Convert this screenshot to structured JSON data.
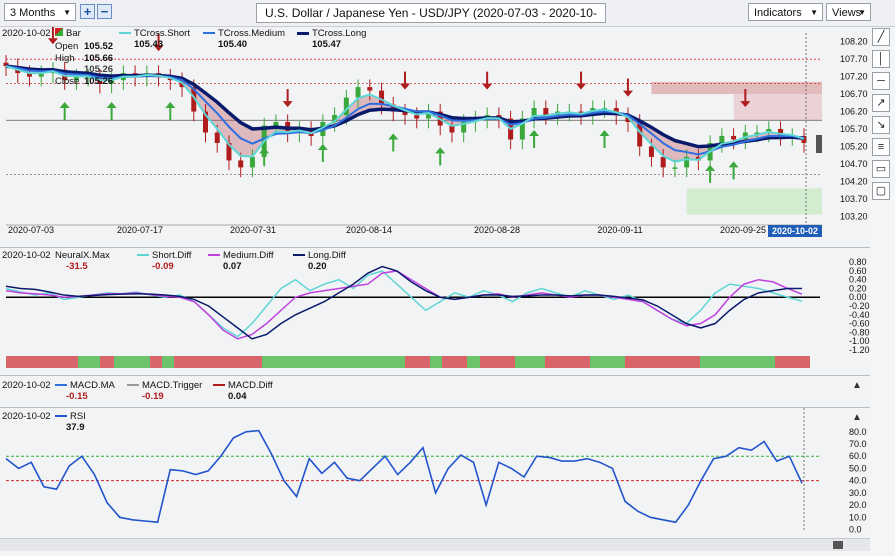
{
  "toolbar": {
    "period": "3 Months",
    "zoom_in": "+",
    "zoom_out": "−",
    "title": "U.S. Dollar / Japanese Yen - USD/JPY (2020-07-03 - 2020-10-05)",
    "indicators": "Indicators",
    "views": "Views"
  },
  "right_tools": [
    "╱",
    "│",
    "─",
    "↗",
    "↘",
    "≡",
    "▭",
    "▢"
  ],
  "legend_main": {
    "date": "2020-10-02",
    "bar_label": "Bar",
    "open_label": "Open",
    "open": "105.52",
    "high_label": "High",
    "high": "105.66",
    "low_label": "Low",
    "low": "105.26",
    "close_label": "Close",
    "close": "105.26",
    "short_label": "TCross.Short",
    "short": "105.43",
    "medium_label": "TCross.Medium",
    "medium": "105.40",
    "long_label": "TCross.Long",
    "long": "105.47"
  },
  "legend_neural": {
    "date": "2020-10-02",
    "nm_label": "NeuralX.Max",
    "nm": "-31.5",
    "sd_label": "Short.Diff",
    "sd": "-0.09",
    "md_label": "Medium.Diff",
    "md": "0.07",
    "ld_label": "Long.Diff",
    "ld": "0.20"
  },
  "legend_macd": {
    "date": "2020-10-02",
    "ma_label": "MACD.MA",
    "ma": "-0.15",
    "tr_label": "MACD.Trigger",
    "tr": "-0.19",
    "df_label": "MACD.Diff",
    "df": "0.04"
  },
  "legend_rsi": {
    "date": "2020-10-02",
    "label": "RSI",
    "value": "37.9"
  },
  "colors": {
    "short": "#5ed6d6",
    "medium": "#2f6fe0",
    "long": "#0a1a6b",
    "up": "#3aa83a",
    "down": "#b01c1c",
    "neural_green": "#6cc36c",
    "neural_red": "#d9646a",
    "rsi": "#2255cc",
    "overbought": "#35b035",
    "oversold": "#d02a2a",
    "highlight": "#1f5fb8"
  },
  "chart_data": [
    {
      "type": "candlestick",
      "title": "U.S. Dollar / Japanese Yen - USD/JPY (2020-07-03 - 2020-10-05)",
      "x_ticks": [
        "2020-07-03",
        "2020-07-17",
        "2020-07-31",
        "2020-08-14",
        "2020-08-28",
        "2020-09-11",
        "2020-09-25",
        "2020-10-02"
      ],
      "y_ticks": [
        103.2,
        103.7,
        104.2,
        104.7,
        105.2,
        105.7,
        106.2,
        106.7,
        107.2,
        107.7,
        108.2
      ],
      "ylim": [
        102.95,
        108.45
      ],
      "close": [
        107.5,
        107.3,
        107.2,
        107.3,
        107.4,
        107.1,
        107.2,
        107.2,
        107.0,
        107.1,
        107.3,
        107.2,
        107.3,
        107.2,
        107.1,
        106.9,
        106.2,
        105.6,
        105.3,
        104.8,
        104.6,
        104.9,
        105.8,
        105.9,
        105.6,
        105.7,
        105.5,
        105.9,
        106.1,
        106.6,
        106.9,
        106.8,
        106.4,
        106.2,
        106.1,
        106.0,
        106.2,
        105.8,
        105.6,
        105.9,
        106.0,
        106.1,
        106.0,
        105.4,
        106.0,
        106.3,
        106.1,
        106.2,
        106.2,
        106.1,
        106.3,
        106.3,
        106.1,
        105.9,
        105.2,
        104.9,
        104.6,
        104.6,
        104.9,
        104.8,
        105.3,
        105.5,
        105.4,
        105.6,
        105.6,
        105.7,
        105.5,
        105.5,
        105.3
      ],
      "ref_lines": [
        107.7,
        107.0,
        105.95,
        104.4
      ],
      "series": [
        {
          "name": "TCross.Short",
          "last": 105.43
        },
        {
          "name": "TCross.Medium",
          "last": 105.4
        },
        {
          "name": "TCross.Long",
          "last": 105.47
        }
      ],
      "last_date": "2020-10-02"
    },
    {
      "type": "line",
      "y_ticks": [
        0.8,
        0.6,
        0.4,
        0.2,
        0.0,
        -0.2,
        -0.4,
        -0.6,
        -0.8,
        -1.0,
        -1.2
      ],
      "ylim": [
        -1.25,
        0.85
      ],
      "series": [
        {
          "name": "Short.Diff",
          "values": [
            0.2,
            0.12,
            0.05,
            0.1,
            -0.05,
            0.0,
            0.05,
            0.1,
            0.08,
            0.12,
            0.05,
            0.0,
            0.05,
            -0.1,
            -0.4,
            -0.7,
            -0.9,
            -0.6,
            -0.2,
            0.2,
            0.4,
            0.15,
            0.3,
            0.4,
            0.2,
            0.5,
            0.6,
            0.3,
            0.0,
            -0.3,
            -0.1,
            0.1,
            0.0,
            0.15,
            0.05,
            -0.1,
            0.1,
            0.2,
            0.1,
            0.0,
            0.15,
            0.05,
            -0.05,
            0.05,
            -0.1,
            -0.3,
            -0.5,
            -0.6,
            -0.3,
            0.1,
            0.3,
            0.25,
            0.2,
            0.1,
            0.0,
            -0.09
          ]
        },
        {
          "name": "Medium.Diff",
          "values": [
            0.15,
            0.1,
            0.08,
            0.05,
            0.0,
            0.02,
            0.05,
            0.08,
            0.08,
            0.1,
            0.06,
            0.02,
            0.0,
            -0.1,
            -0.4,
            -0.75,
            -0.95,
            -0.85,
            -0.6,
            -0.3,
            0.0,
            0.1,
            0.15,
            0.2,
            0.25,
            0.3,
            0.55,
            0.6,
            0.4,
            0.2,
            0.0,
            -0.05,
            0.0,
            0.05,
            0.08,
            0.0,
            0.05,
            0.1,
            0.05,
            0.0,
            0.05,
            0.05,
            0.0,
            -0.05,
            -0.1,
            -0.3,
            -0.5,
            -0.65,
            -0.6,
            -0.4,
            0.0,
            0.3,
            0.4,
            0.35,
            0.2,
            0.07
          ]
        },
        {
          "name": "Long.Diff",
          "values": [
            0.25,
            0.2,
            0.18,
            0.12,
            0.05,
            0.02,
            0.04,
            0.06,
            0.07,
            0.08,
            0.07,
            0.05,
            0.02,
            -0.05,
            -0.2,
            -0.45,
            -0.7,
            -0.95,
            -0.85,
            -0.6,
            -0.4,
            -0.25,
            -0.1,
            0.1,
            0.3,
            0.55,
            0.7,
            0.6,
            0.35,
            0.15,
            0.0,
            -0.05,
            0.0,
            0.05,
            0.05,
            0.02,
            0.03,
            0.05,
            0.05,
            0.03,
            0.05,
            0.05,
            0.02,
            -0.02,
            -0.06,
            -0.2,
            -0.4,
            -0.6,
            -0.7,
            -0.6,
            -0.3,
            -0.05,
            0.1,
            0.15,
            0.2,
            0.2
          ]
        }
      ],
      "neuralx_max_last": -31.5
    },
    {
      "type": "line",
      "series": [
        {
          "name": "MACD.MA",
          "last": -0.15
        },
        {
          "name": "MACD.Trigger",
          "last": -0.19
        },
        {
          "name": "MACD.Diff",
          "last": 0.04
        }
      ]
    },
    {
      "type": "line",
      "y_ticks": [
        80.0,
        70.0,
        60.0,
        50.0,
        40.0,
        30.0,
        20.0,
        10.0,
        0.0
      ],
      "ylim": [
        -2,
        88
      ],
      "reference_lines": [
        60,
        40
      ],
      "series": [
        {
          "name": "RSI",
          "values": [
            58,
            50,
            55,
            35,
            33,
            52,
            60,
            45,
            22,
            10,
            8,
            7,
            6,
            49,
            48,
            45,
            48,
            60,
            75,
            80,
            81,
            62,
            40,
            27,
            58,
            46,
            55,
            42,
            40,
            50,
            60,
            45,
            55,
            67,
            30,
            50,
            61,
            55,
            20,
            55,
            50,
            43,
            60,
            59,
            56,
            56,
            58,
            55,
            50,
            23,
            15,
            10,
            8,
            6,
            20,
            40,
            58,
            60,
            67,
            65,
            72,
            56,
            60,
            37.9
          ]
        }
      ],
      "last": 37.9
    }
  ]
}
